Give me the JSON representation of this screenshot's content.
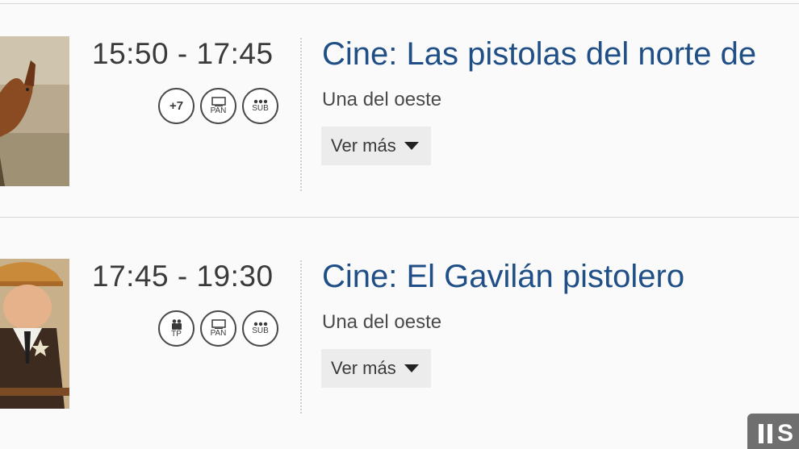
{
  "programmes": [
    {
      "time": "15:50 - 17:45",
      "title": "Cine: Las pistolas del norte de",
      "genre": "Una del oeste",
      "more_label": "Ver más",
      "badges": [
        {
          "icon": "age-rating-icon",
          "text": "+7"
        },
        {
          "icon": "panoramic-icon",
          "text": "PAN"
        },
        {
          "icon": "subtitles-icon",
          "text": "SUB"
        }
      ]
    },
    {
      "time": "17:45 - 19:30",
      "title": "Cine: El Gavilán pistolero",
      "genre": "Una del oeste",
      "more_label": "Ver más",
      "badges": [
        {
          "icon": "all-audiences-icon",
          "text": "TP"
        },
        {
          "icon": "panoramic-icon",
          "text": "PAN"
        },
        {
          "icon": "subtitles-icon",
          "text": "SUB"
        }
      ]
    }
  ],
  "pause_widget": {
    "icon": "pause-icon",
    "text": "S"
  },
  "colors": {
    "title": "#1f4f86",
    "time": "#3a3a3a",
    "button_bg": "#ececec",
    "background": "#fafafa"
  }
}
